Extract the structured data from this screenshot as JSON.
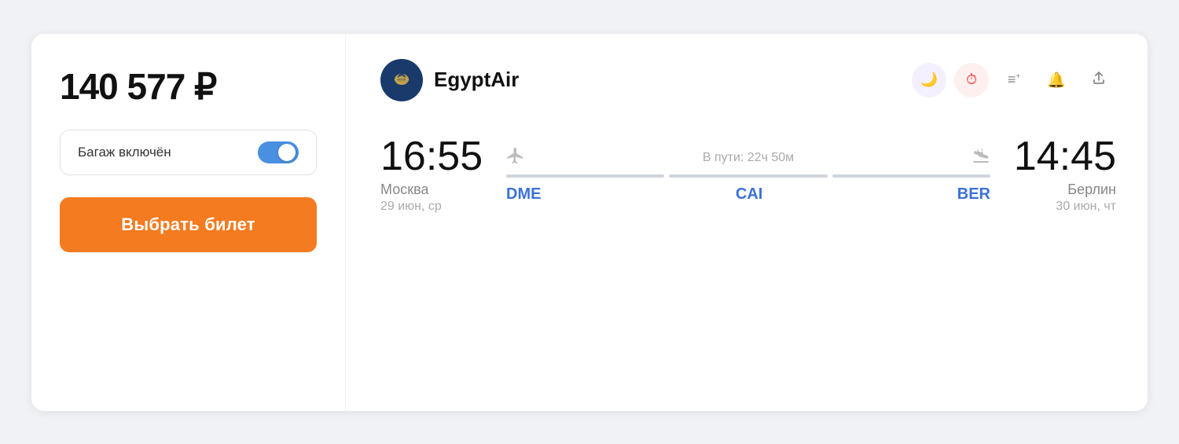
{
  "left": {
    "price": "140 577 ₽",
    "baggage_label": "Багаж включён",
    "toggle_on": true,
    "select_btn_label": "Выбрать билет"
  },
  "right": {
    "airline_name": "EgyptAir",
    "icons": {
      "moon": "🌙",
      "hourglass": "⏳",
      "filter": "≡+",
      "bell": "🔔",
      "share": "⬆"
    },
    "departure": {
      "time": "16:55",
      "city": "Москва",
      "date": "29 июн, ср"
    },
    "route": {
      "duration": "В пути: 22ч 50м",
      "airports": [
        "DME",
        "CAI",
        "BER"
      ]
    },
    "arrival": {
      "time": "14:45",
      "city": "Берлин",
      "date": "30 июн, чт"
    }
  }
}
